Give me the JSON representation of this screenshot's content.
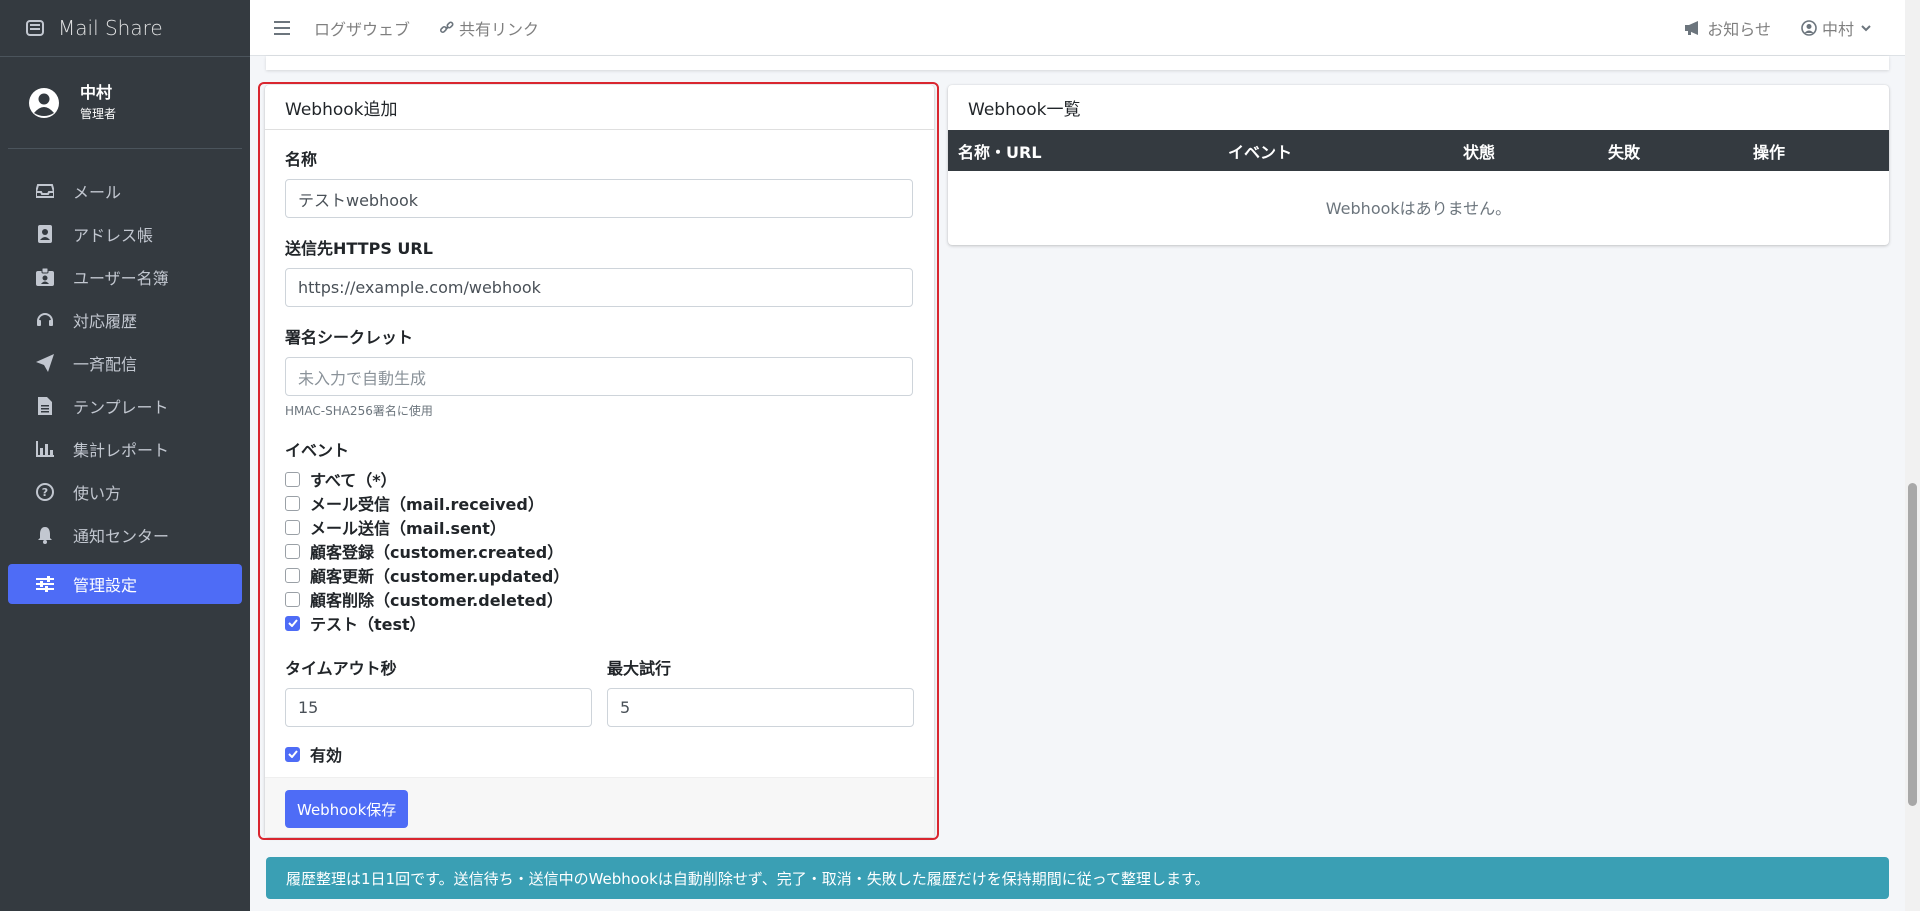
{
  "brand": {
    "name": "Mail Share"
  },
  "user": {
    "name": "中村",
    "role": "管理者"
  },
  "sidebar": {
    "items": [
      {
        "label": "メール",
        "icon": "inbox-icon"
      },
      {
        "label": "アドレス帳",
        "icon": "address-book-icon"
      },
      {
        "label": "ユーザー名簿",
        "icon": "id-badge-icon"
      },
      {
        "label": "対応履歴",
        "icon": "headset-icon"
      },
      {
        "label": "一斉配信",
        "icon": "paper-plane-icon"
      },
      {
        "label": "テンプレート",
        "icon": "file-icon"
      },
      {
        "label": "集計レポート",
        "icon": "bar-chart-icon"
      },
      {
        "label": "使い方",
        "icon": "question-circle-icon"
      },
      {
        "label": "通知センター",
        "icon": "bell-icon"
      },
      {
        "label": "管理設定",
        "icon": "sliders-icon",
        "active": true
      }
    ]
  },
  "topbar": {
    "links": [
      "ログザウェブ",
      "共有リンク"
    ],
    "notifications": "お知らせ",
    "user_menu": "中村"
  },
  "add_card": {
    "title": "Webhook追加",
    "name_label": "名称",
    "name_value": "テストwebhook",
    "url_label": "送信先HTTPS URL",
    "url_value": "https://example.com/webhook",
    "secret_label": "署名シークレット",
    "secret_placeholder": "未入力で自動生成",
    "secret_help": "HMAC-SHA256署名に使用",
    "events_label": "イベント",
    "events": [
      {
        "label": "すべて（*）",
        "checked": false
      },
      {
        "label": "メール受信（mail.received）",
        "checked": false
      },
      {
        "label": "メール送信（mail.sent）",
        "checked": false
      },
      {
        "label": "顧客登録（customer.created）",
        "checked": false
      },
      {
        "label": "顧客更新（customer.updated）",
        "checked": false
      },
      {
        "label": "顧客削除（customer.deleted）",
        "checked": false
      },
      {
        "label": "テスト（test）",
        "checked": true
      }
    ],
    "timeout_label": "タイムアウト秒",
    "timeout_value": "15",
    "retry_label": "最大試行",
    "retry_value": "5",
    "enabled_label": "有効",
    "enabled": true,
    "save_button": "Webhook保存"
  },
  "list_card": {
    "title": "Webhook一覧",
    "columns": [
      "名称・URL",
      "イベント",
      "状態",
      "失敗",
      "操作"
    ],
    "empty": "Webhookはありません。"
  },
  "alert": {
    "text": "履歴整理は1日1回です。送信待ち・送信中のWebhookは自動削除せず、完了・取消・失敗した履歴だけを保持期間に従って整理します。"
  },
  "colors": {
    "accent": "#4e6cf6",
    "sidebar": "#343a40",
    "alert": "#3a9fb4",
    "highlight": "#d9262f"
  }
}
